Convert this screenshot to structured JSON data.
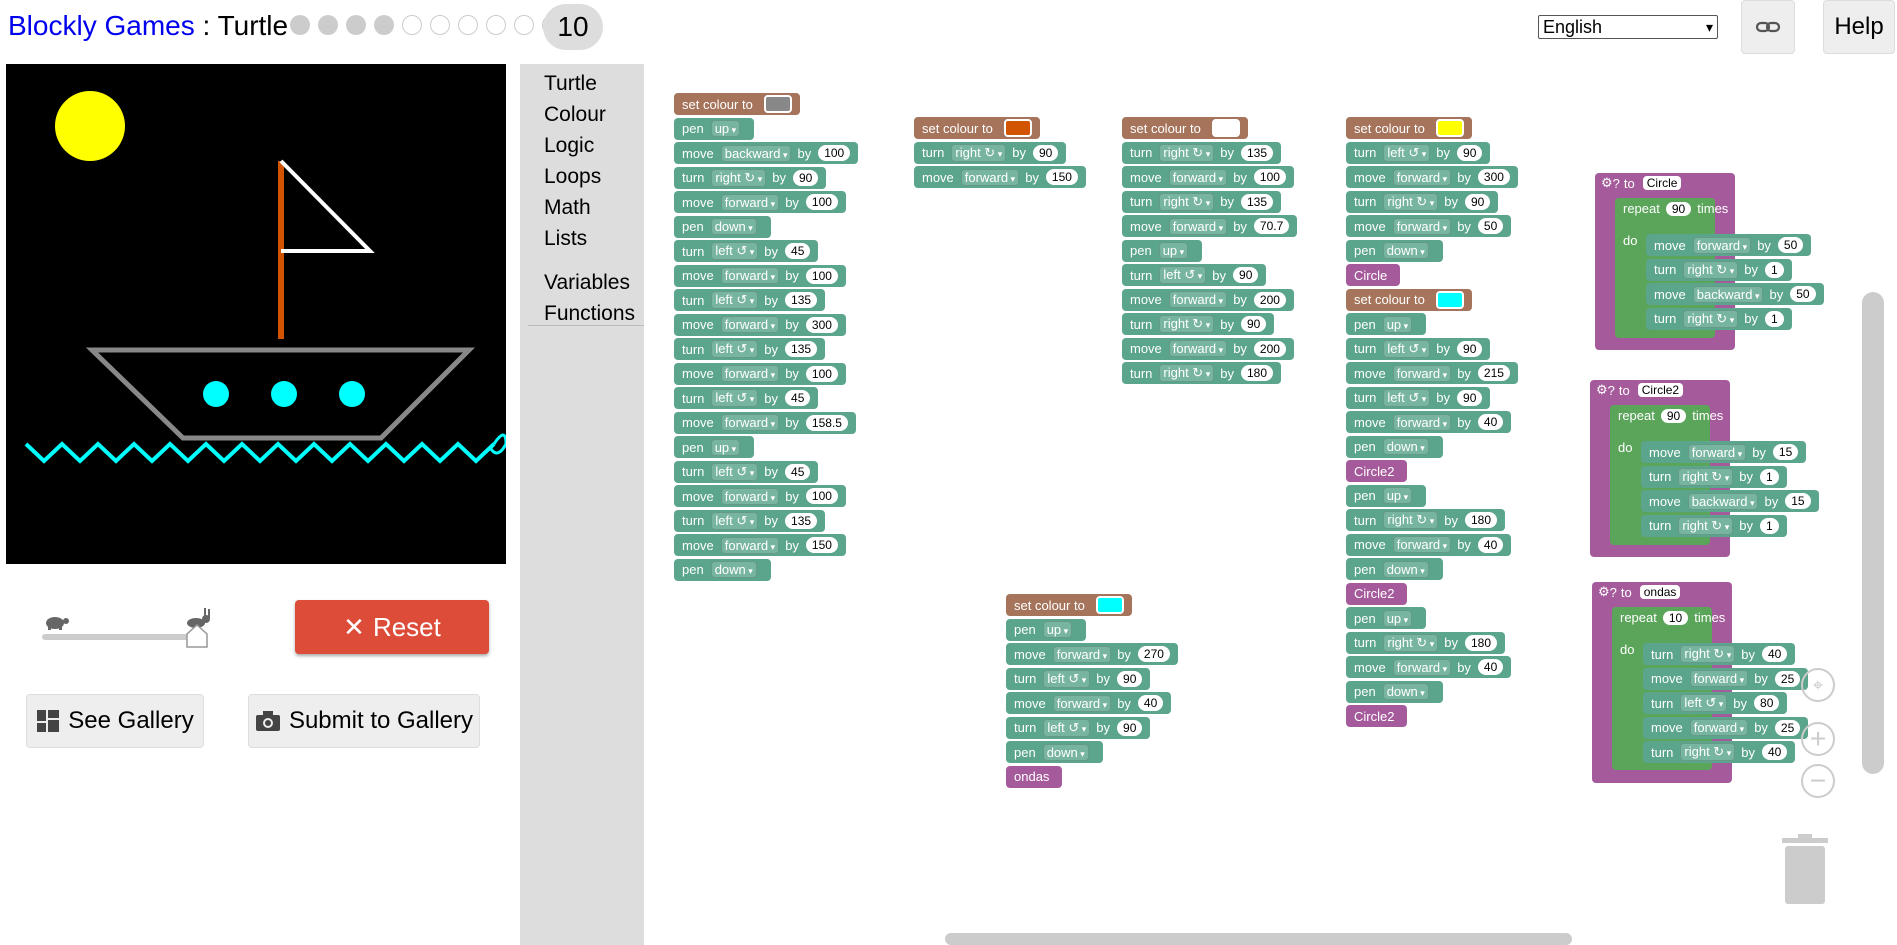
{
  "header": {
    "app_name": "Blockly Games",
    "separator": " : ",
    "page": "Turtle",
    "level_number": "10",
    "levels_done": 4,
    "levels_total": 10,
    "language": "English",
    "link_icon": "link-icon",
    "help_label": "Help"
  },
  "controls": {
    "speed_slow_icon": "turtle-icon",
    "speed_fast_icon": "rabbit-icon",
    "speed_level": 1.0,
    "reset_label": "Reset",
    "gallery_label": "See Gallery",
    "submit_label": "Submit to Gallery"
  },
  "toolbox": [
    "Turtle",
    "Colour",
    "Logic",
    "Loops",
    "Math",
    "Lists",
    "Variables",
    "Functions"
  ],
  "colors": {
    "motion_block": "#5ba58c",
    "colour_block": "#a5745b",
    "procedure_block": "#a55b9b",
    "loop_block": "#5ba55b",
    "reset_button": "#dd4b39"
  },
  "stacks": {
    "s1": [
      {
        "k": "b",
        "t": "set colour to",
        "sw": "#888888"
      },
      {
        "k": "g",
        "t": "pen",
        "dd": "up"
      },
      {
        "k": "g",
        "t": "move",
        "dd": "backward",
        "by": "100"
      },
      {
        "k": "g",
        "t": "turn",
        "dd": "right ↻",
        "by": "90"
      },
      {
        "k": "g",
        "t": "move",
        "dd": "forward",
        "by": "100"
      },
      {
        "k": "g",
        "t": "pen",
        "dd": "down"
      },
      {
        "k": "g",
        "t": "turn",
        "dd": "left ↺",
        "by": "45"
      },
      {
        "k": "g",
        "t": "move",
        "dd": "forward",
        "by": "100"
      },
      {
        "k": "g",
        "t": "turn",
        "dd": "left ↺",
        "by": "135"
      },
      {
        "k": "g",
        "t": "move",
        "dd": "forward",
        "by": "300"
      },
      {
        "k": "g",
        "t": "turn",
        "dd": "left ↺",
        "by": "135"
      },
      {
        "k": "g",
        "t": "move",
        "dd": "forward",
        "by": "100"
      },
      {
        "k": "g",
        "t": "turn",
        "dd": "left ↺",
        "by": "45"
      },
      {
        "k": "g",
        "t": "move",
        "dd": "forward",
        "by": "158.5"
      },
      {
        "k": "g",
        "t": "pen",
        "dd": "up"
      },
      {
        "k": "g",
        "t": "turn",
        "dd": "left ↺",
        "by": "45"
      },
      {
        "k": "g",
        "t": "move",
        "dd": "forward",
        "by": "100"
      },
      {
        "k": "g",
        "t": "turn",
        "dd": "left ↺",
        "by": "135"
      },
      {
        "k": "g",
        "t": "move",
        "dd": "forward",
        "by": "150"
      },
      {
        "k": "g",
        "t": "pen",
        "dd": "down"
      }
    ],
    "s2": [
      {
        "k": "b",
        "t": "set colour to",
        "sw": "#d35400"
      },
      {
        "k": "g",
        "t": "turn",
        "dd": "right ↻",
        "by": "90"
      },
      {
        "k": "g",
        "t": "move",
        "dd": "forward",
        "by": "150"
      }
    ],
    "s3": [
      {
        "k": "b",
        "t": "set colour to",
        "sw": "#ffffff"
      },
      {
        "k": "g",
        "t": "turn",
        "dd": "right ↻",
        "by": "135"
      },
      {
        "k": "g",
        "t": "move",
        "dd": "forward",
        "by": "100"
      },
      {
        "k": "g",
        "t": "turn",
        "dd": "right ↻",
        "by": "135"
      },
      {
        "k": "g",
        "t": "move",
        "dd": "forward",
        "by": "70.7"
      },
      {
        "k": "g",
        "t": "pen",
        "dd": "up"
      },
      {
        "k": "g",
        "t": "turn",
        "dd": "left ↺",
        "by": "90"
      },
      {
        "k": "g",
        "t": "move",
        "dd": "forward",
        "by": "200"
      },
      {
        "k": "g",
        "t": "turn",
        "dd": "right ↻",
        "by": "90"
      },
      {
        "k": "g",
        "t": "move",
        "dd": "forward",
        "by": "200"
      },
      {
        "k": "g",
        "t": "turn",
        "dd": "right ↻",
        "by": "180"
      }
    ],
    "s4": [
      {
        "k": "b",
        "t": "set colour to",
        "sw": "#ffff00"
      },
      {
        "k": "g",
        "t": "turn",
        "dd": "left ↺",
        "by": "90"
      },
      {
        "k": "g",
        "t": "move",
        "dd": "forward",
        "by": "300"
      },
      {
        "k": "g",
        "t": "turn",
        "dd": "right ↻",
        "by": "90"
      },
      {
        "k": "g",
        "t": "move",
        "dd": "forward",
        "by": "50"
      },
      {
        "k": "g",
        "t": "pen",
        "dd": "down"
      },
      {
        "k": "p",
        "t": "Circle"
      },
      {
        "k": "b",
        "t": "set colour to",
        "sw": "#00ffff"
      },
      {
        "k": "g",
        "t": "pen",
        "dd": "up"
      },
      {
        "k": "g",
        "t": "turn",
        "dd": "left ↺",
        "by": "90"
      },
      {
        "k": "g",
        "t": "move",
        "dd": "forward",
        "by": "215"
      },
      {
        "k": "g",
        "t": "turn",
        "dd": "left ↺",
        "by": "90"
      },
      {
        "k": "g",
        "t": "move",
        "dd": "forward",
        "by": "40"
      },
      {
        "k": "g",
        "t": "pen",
        "dd": "down"
      },
      {
        "k": "p",
        "t": "Circle2"
      },
      {
        "k": "g",
        "t": "pen",
        "dd": "up"
      },
      {
        "k": "g",
        "t": "turn",
        "dd": "right ↻",
        "by": "180"
      },
      {
        "k": "g",
        "t": "move",
        "dd": "forward",
        "by": "40"
      },
      {
        "k": "g",
        "t": "pen",
        "dd": "down"
      },
      {
        "k": "p",
        "t": "Circle2"
      },
      {
        "k": "g",
        "t": "pen",
        "dd": "up"
      },
      {
        "k": "g",
        "t": "turn",
        "dd": "right ↻",
        "by": "180"
      },
      {
        "k": "g",
        "t": "move",
        "dd": "forward",
        "by": "40"
      },
      {
        "k": "g",
        "t": "pen",
        "dd": "down"
      },
      {
        "k": "p",
        "t": "Circle2"
      }
    ],
    "s5": [
      {
        "k": "b",
        "t": "set colour to",
        "sw": "#00ffff"
      },
      {
        "k": "g",
        "t": "pen",
        "dd": "up"
      },
      {
        "k": "g",
        "t": "move",
        "dd": "forward",
        "by": "270"
      },
      {
        "k": "g",
        "t": "turn",
        "dd": "left ↺",
        "by": "90"
      },
      {
        "k": "g",
        "t": "move",
        "dd": "forward",
        "by": "40"
      },
      {
        "k": "g",
        "t": "turn",
        "dd": "left ↺",
        "by": "90"
      },
      {
        "k": "g",
        "t": "pen",
        "dd": "down"
      },
      {
        "k": "p",
        "t": "ondas"
      }
    ]
  },
  "functions": [
    {
      "to_label": "to",
      "name": "Circle",
      "repeat_label": "repeat",
      "times": "90",
      "times_label": "times",
      "do_label": "do",
      "body": [
        {
          "k": "g",
          "t": "move",
          "dd": "forward",
          "by": "50"
        },
        {
          "k": "g",
          "t": "turn",
          "dd": "right ↻",
          "by": "1"
        },
        {
          "k": "g",
          "t": "move",
          "dd": "backward",
          "by": "50"
        },
        {
          "k": "g",
          "t": "turn",
          "dd": "right ↻",
          "by": "1"
        }
      ]
    },
    {
      "to_label": "to",
      "name": "Circle2",
      "repeat_label": "repeat",
      "times": "90",
      "times_label": "times",
      "do_label": "do",
      "body": [
        {
          "k": "g",
          "t": "move",
          "dd": "forward",
          "by": "15"
        },
        {
          "k": "g",
          "t": "turn",
          "dd": "right ↻",
          "by": "1"
        },
        {
          "k": "g",
          "t": "move",
          "dd": "backward",
          "by": "15"
        },
        {
          "k": "g",
          "t": "turn",
          "dd": "right ↻",
          "by": "1"
        }
      ]
    },
    {
      "to_label": "to",
      "name": "ondas",
      "repeat_label": "repeat",
      "times": "10",
      "times_label": "times",
      "do_label": "do",
      "body": [
        {
          "k": "g",
          "t": "turn",
          "dd": "right ↻",
          "by": "40"
        },
        {
          "k": "g",
          "t": "move",
          "dd": "forward",
          "by": "25"
        },
        {
          "k": "g",
          "t": "turn",
          "dd": "left ↺",
          "by": "80"
        },
        {
          "k": "g",
          "t": "move",
          "dd": "forward",
          "by": "25"
        },
        {
          "k": "g",
          "t": "turn",
          "dd": "right ↻",
          "by": "40"
        }
      ]
    }
  ],
  "by_label": "by",
  "workspace_icons": {
    "center": "target-icon",
    "zoom_in": "zoom-in-icon",
    "zoom_out": "zoom-out-icon",
    "trash": "trash-icon"
  }
}
